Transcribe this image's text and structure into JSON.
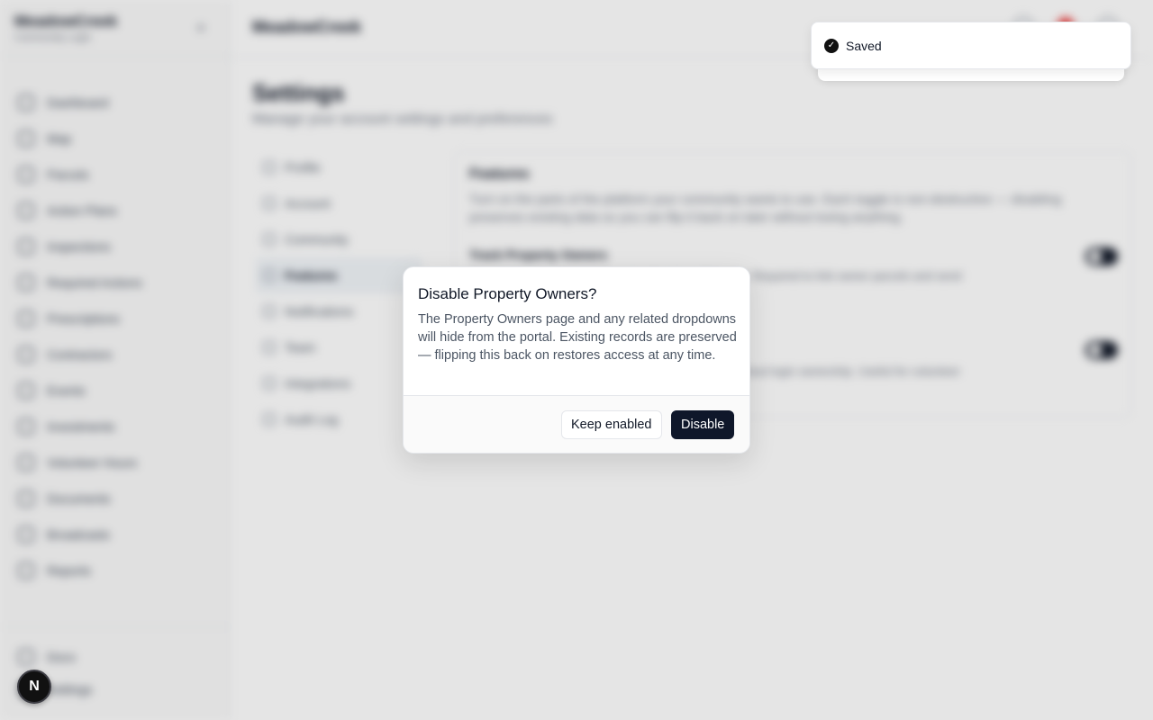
{
  "app": {
    "brand_name": "MeadowCreek",
    "brand_sub": "Community Login",
    "header_title": "MeadowCreek"
  },
  "sidebar": {
    "items": [
      {
        "label": "Dashboard",
        "icon": "dashboard-icon"
      },
      {
        "label": "Map",
        "icon": "map-icon"
      },
      {
        "label": "Parcels",
        "icon": "parcels-icon"
      },
      {
        "label": "Action Plans",
        "icon": "action-plans-icon"
      },
      {
        "label": "Inspections",
        "icon": "inspections-icon"
      },
      {
        "label": "Required Actions",
        "icon": "required-actions-icon"
      },
      {
        "label": "Prescriptions",
        "icon": "prescriptions-icon"
      },
      {
        "label": "Contractors",
        "icon": "contractors-icon"
      },
      {
        "label": "Events",
        "icon": "events-icon"
      },
      {
        "label": "Investments",
        "icon": "investments-icon"
      },
      {
        "label": "Volunteer Hours",
        "icon": "volunteer-icon"
      },
      {
        "label": "Documents",
        "icon": "documents-icon"
      },
      {
        "label": "Broadcasts",
        "icon": "broadcasts-icon"
      },
      {
        "label": "Reports",
        "icon": "reports-icon"
      }
    ],
    "bottom": [
      {
        "label": "Docs",
        "icon": "docs-icon"
      },
      {
        "label": "Settings",
        "icon": "settings-icon"
      }
    ]
  },
  "settings": {
    "title": "Settings",
    "subtitle": "Manage your account settings and preferences",
    "nav": [
      {
        "label": "Profile"
      },
      {
        "label": "Account"
      },
      {
        "label": "Community"
      },
      {
        "label": "Features"
      },
      {
        "label": "Notifications"
      },
      {
        "label": "Team"
      },
      {
        "label": "Integrations"
      },
      {
        "label": "Audit Log"
      }
    ],
    "features_card": {
      "title": "Features",
      "description": "Turn on the parts of the platform your community wants to use. Each toggle is non-destructive — disabling preserves existing data so you can flip it back on later without losing anything.",
      "feature_1_name": "Track Property Owners",
      "feature_1_desc": "Owner records, contact info and optional portal logins. Required to link owner parcels and send notifications.",
      "feature_2_desc": "Let community members participate anonymously without login ownership. Useful for volunteer days and open events for non-owner participants."
    }
  },
  "toast": {
    "text": "Saved"
  },
  "dialog": {
    "title": "Disable Property Owners?",
    "body": "The Property Owners page and any related dropdowns will hide from the portal. Existing records are preserved — flipping this back on restores access at any time.",
    "cancel_label": "Keep enabled",
    "confirm_label": "Disable"
  },
  "badge": {
    "letter": "N"
  },
  "colors": {
    "primary": "#0f172a",
    "notification": "#ef4444",
    "toggle_on": "#111827"
  }
}
